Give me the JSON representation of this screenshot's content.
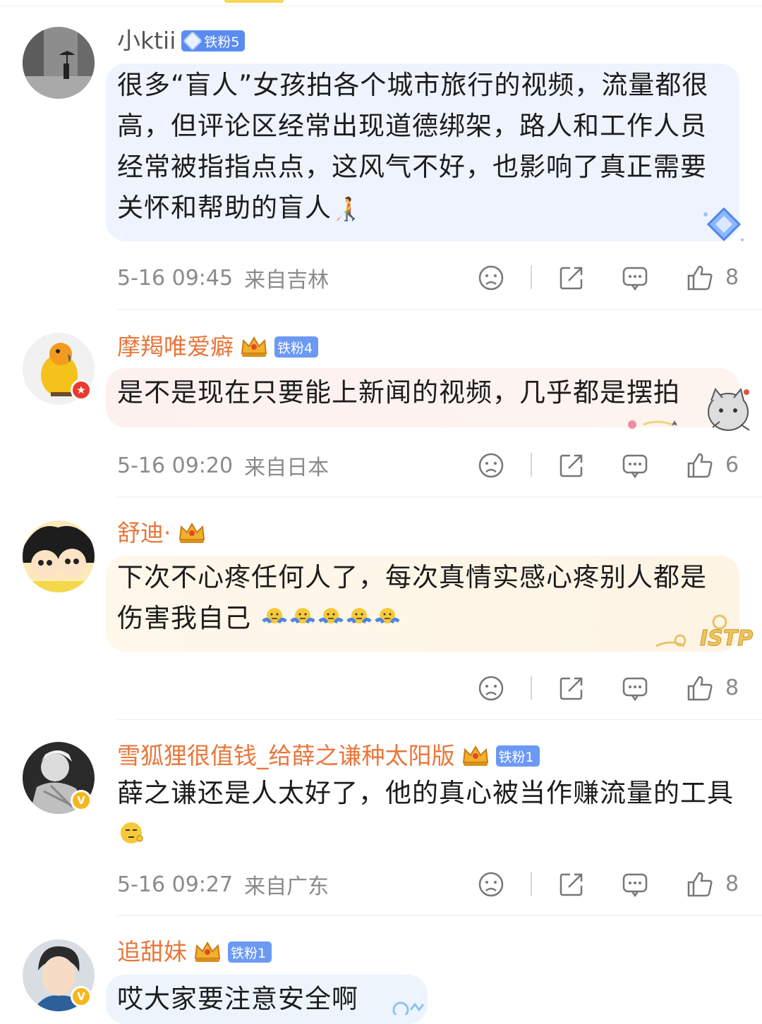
{
  "comments": [
    {
      "username": "小ktii",
      "fan_badge": "铁粉5",
      "text": "很多“盲人”女孩拍各个城市旅行的视频，流量都很高，但评论区经常出现道德绑架，路人和工作人员经常被指指点点，这风气不好，也影响了真正需要关怀和帮助的盲人",
      "trailing_emoji": "🧑‍🦯",
      "time": "5-16 09:45",
      "location": "来自吉林",
      "likes": "8",
      "bubble_color": "#eef3fd"
    },
    {
      "username": "摩羯唯爱癖",
      "fan_badge": "铁粉4",
      "text": "是不是现在只要能上新闻的视频，几乎都是摆拍",
      "time": "5-16 09:20",
      "location": "来自日本",
      "likes": "6",
      "bubble_color": "#fdf1ef"
    },
    {
      "username": "舒迪·",
      "text": "下次不心疼任何人了，每次真情实感心疼别人都是伤害我自己",
      "time": "",
      "location": "",
      "likes": "8",
      "bubble_color": "#fdf6e8",
      "bubble_decoration_text": "ISTP"
    },
    {
      "username": "雪狐狸很值钱_给薛之谦种太阳版",
      "fan_badge": "铁粉1",
      "text": "薛之谦还是人太好了，他的真心被当作赚流量的工具",
      "time": "5-16 09:27",
      "location": "来自广东",
      "likes": "8"
    },
    {
      "username": "追甜妹",
      "fan_badge": "铁粉1",
      "text": "哎大家要注意安全啊",
      "bubble_color": "#edf4fc"
    }
  ],
  "icons": {
    "dislike": "sad-face-icon",
    "share": "share-icon",
    "reply": "comment-icon",
    "like": "thumbs-up-icon"
  },
  "colors": {
    "vip_name": "#e8763a",
    "plain_name": "#555555",
    "fan_badge": "#5a8cf0",
    "meta_text": "#8a8a8a"
  }
}
